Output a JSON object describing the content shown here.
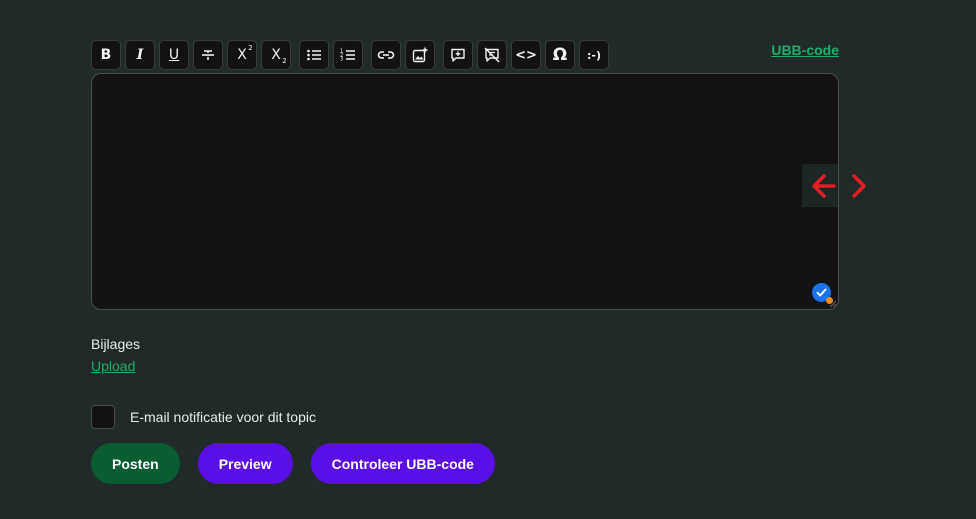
{
  "toolbar": {
    "buttons": [
      {
        "id": "bold",
        "glyph": "B"
      },
      {
        "id": "italic",
        "glyph": "I"
      },
      {
        "id": "underline",
        "glyph": "U"
      },
      {
        "id": "strikethrough",
        "glyph": "S"
      },
      {
        "id": "superscript",
        "glyph": "X"
      },
      {
        "id": "subscript",
        "glyph": "X"
      },
      {
        "id": "bullet-list"
      },
      {
        "id": "numbered-list"
      },
      {
        "id": "link"
      },
      {
        "id": "image"
      },
      {
        "id": "quote"
      },
      {
        "id": "spoiler"
      },
      {
        "id": "code",
        "glyph": "<>"
      },
      {
        "id": "special-char",
        "glyph": "Ω"
      },
      {
        "id": "smiley",
        "glyph": ":-)"
      }
    ],
    "ubb_link_label": "UBB-code"
  },
  "editor": {
    "value": ""
  },
  "attachments": {
    "title": "Bijlages",
    "upload_label": "Upload"
  },
  "notify": {
    "label": "E-mail notificatie voor dit topic",
    "checked": false
  },
  "actions": {
    "post_label": "Posten",
    "preview_label": "Preview",
    "check_label": "Controleer UBB-code"
  },
  "colors": {
    "background": "#202b29",
    "accent_green": "#1fae6a",
    "post_button": "#0a5c33",
    "purple_button": "#5a0fe6",
    "resize_arrows": "#e01e26"
  }
}
